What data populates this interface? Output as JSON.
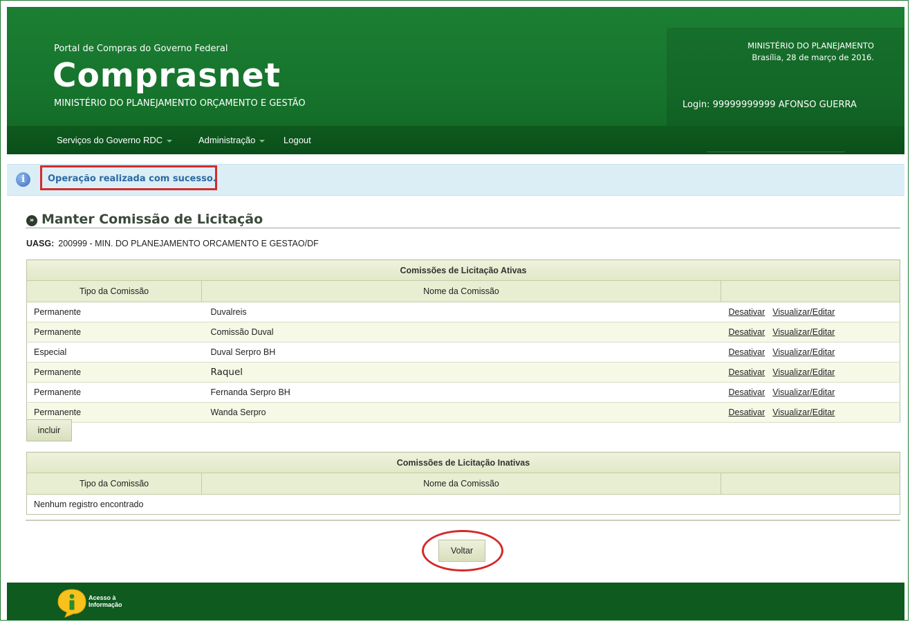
{
  "header": {
    "portal_label": "Portal de Compras do Governo Federal",
    "logo": "Comprasnet",
    "subtitle": "MINISTÉRIO DO PLANEJAMENTO ORÇAMENTO E GESTÃO",
    "ministry": "MINISTÉRIO DO PLANEJAMENTO",
    "date": "Brasília, 28 de março de 2016.",
    "login": "Login: 99999999999 AFONSO GUERRA",
    "brand_color": "#1b7f33"
  },
  "nav": {
    "items": [
      {
        "label": "Serviços do Governo RDC",
        "has_dropdown": true
      },
      {
        "label": "Administração",
        "has_dropdown": true
      },
      {
        "label": "Logout",
        "has_dropdown": false
      }
    ]
  },
  "alert": {
    "icon": "info-icon",
    "message": "Operação realizada com sucesso."
  },
  "page": {
    "title": "Manter Comissão de Licitação",
    "uasg_label": "UASG:",
    "uasg_value": "200999 - MIN. DO PLANEJAMENTO ORCAMENTO E GESTAO/DF"
  },
  "active_table": {
    "caption": "Comissões de Licitação Ativas",
    "col_tipo": "Tipo da Comissão",
    "col_nome": "Nome da Comissão",
    "action_deactivate": "Desativar",
    "action_view": "Visualizar/Editar",
    "rows": [
      {
        "tipo": "Permanente",
        "nome": "Duvalreis"
      },
      {
        "tipo": "Permanente",
        "nome": "Comissão Duval"
      },
      {
        "tipo": "Especial",
        "nome": "Duval Serpro BH"
      },
      {
        "tipo": "Permanente",
        "nome": "Raquel"
      },
      {
        "tipo": "Permanente",
        "nome": "Fernanda Serpro BH"
      },
      {
        "tipo": "Permanente",
        "nome": "Wanda Serpro"
      }
    ]
  },
  "include_button": "incluir",
  "inactive_table": {
    "caption": "Comissões de Licitação Inativas",
    "col_tipo": "Tipo da Comissão",
    "col_nome": "Nome da Comissão",
    "empty_message": "Nenhum registro encontrado"
  },
  "back_button": "Voltar",
  "footer": {
    "acesso_line1": "Acesso à",
    "acesso_line2": "Informação"
  }
}
